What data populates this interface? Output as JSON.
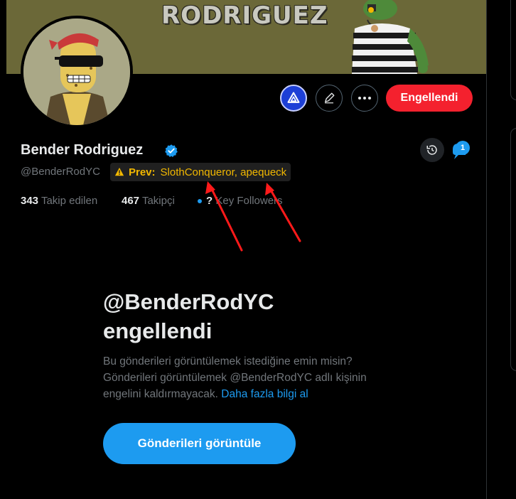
{
  "banner": {
    "text": "RODRIGUEZ"
  },
  "profile": {
    "name": "Bender Rodriguez",
    "handle": "@BenderRodYC",
    "prev_label": "Prev:",
    "prev_names": "SlothConqueror, apequeck"
  },
  "actions": {
    "blocked_label": "Engellendi"
  },
  "notifications": {
    "badge": "1"
  },
  "stats": {
    "following_count": "343",
    "following_label": "Takip edilen",
    "followers_count": "467",
    "followers_label": "Takipçi",
    "key_followers_count": "?",
    "key_followers_label": "Key Followers"
  },
  "blocked_notice": {
    "title_line1": "@BenderRodYC",
    "title_line2": "engellendi",
    "description": "Bu gönderileri görüntülemek istediğine emin misin? Gönderileri görüntülemek @BenderRodYC adlı kişinin engelini kaldırmayacak.",
    "link": "Daha fazla bilgi al",
    "button_label": "Gönderileri görüntüle"
  },
  "colors": {
    "accent": "#1d9bf0",
    "blocked_red": "#f4212e",
    "warning_yellow": "#f2b800",
    "annotation_arrow": "#ff1a1a"
  }
}
